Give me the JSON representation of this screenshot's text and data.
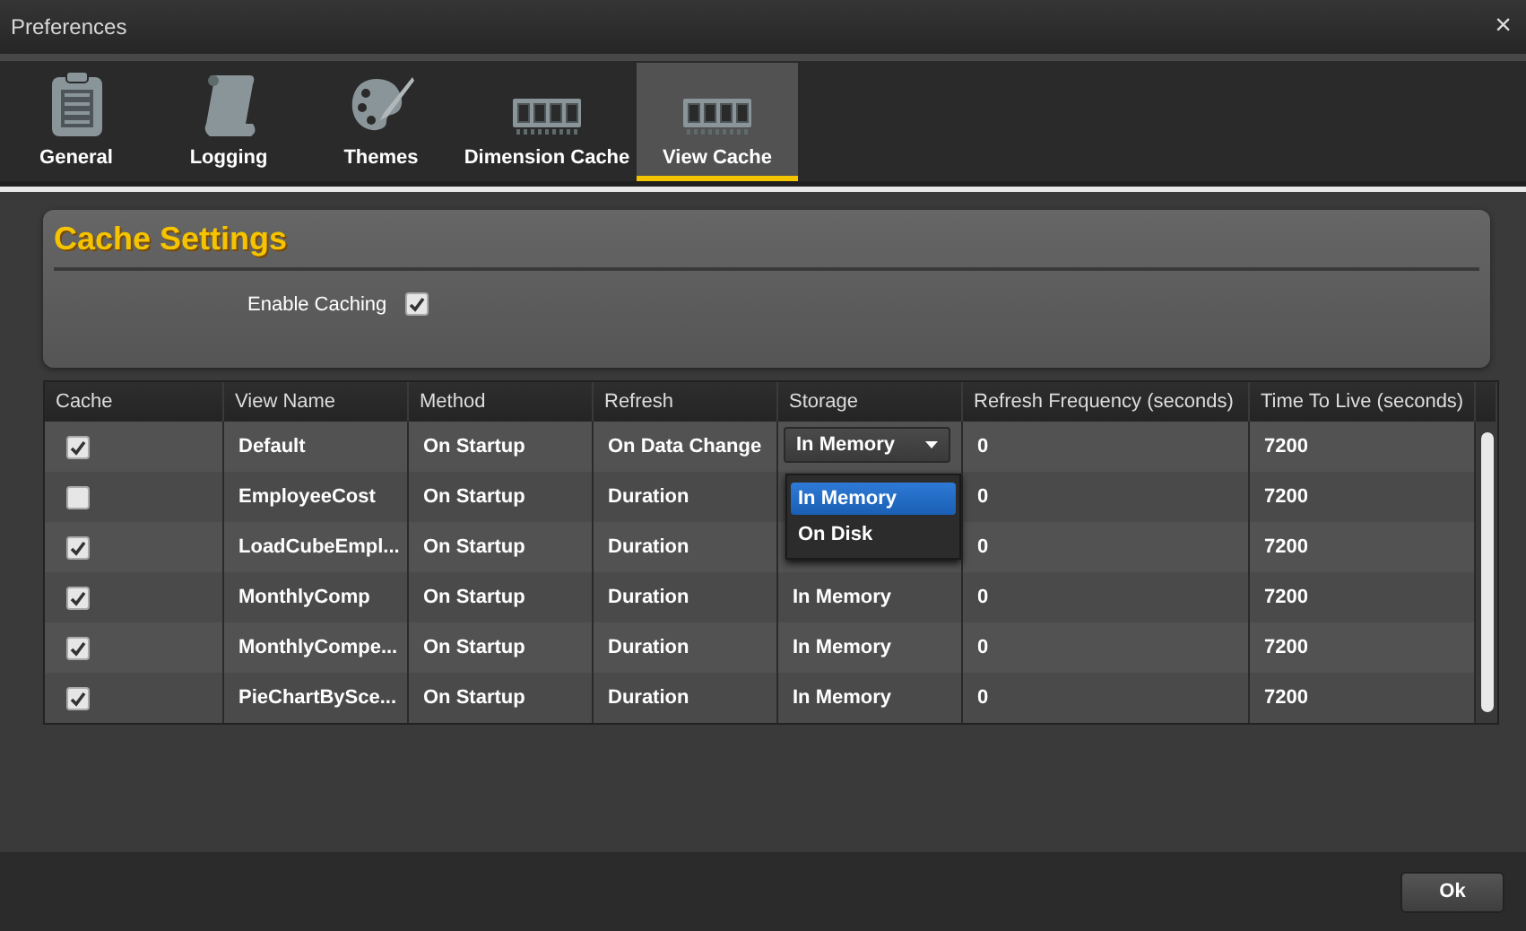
{
  "window": {
    "title": "Preferences",
    "close": "×"
  },
  "tabs": [
    {
      "label": "General",
      "kind": "clipboard",
      "selected": false
    },
    {
      "label": "Logging",
      "kind": "scroll",
      "selected": false
    },
    {
      "label": "Themes",
      "kind": "palette",
      "selected": false
    },
    {
      "label": "Dimension Cache",
      "kind": "memory",
      "selected": false
    },
    {
      "label": "View Cache",
      "kind": "memory",
      "selected": true
    }
  ],
  "settings": {
    "title": "Cache Settings",
    "enable_label": "Enable Caching",
    "enable_checked": true
  },
  "table": {
    "columns": [
      "Cache",
      "View Name",
      "Method",
      "Refresh",
      "Storage",
      "Refresh Frequency (seconds)",
      "Time To Live (seconds)"
    ],
    "rows": [
      {
        "checked": true,
        "name": "Default",
        "method": "On Startup",
        "refresh": "On Data Change",
        "storage": "In Memory",
        "kind": "dropdown",
        "frequency": "0",
        "ttl": "7200"
      },
      {
        "checked": false,
        "name": "EmployeeCost",
        "method": "On Startup",
        "refresh": "Duration",
        "frequency": "0",
        "ttl": "7200"
      },
      {
        "checked": true,
        "name": "LoadCubeEmpl...",
        "method": "On Startup",
        "refresh": "Duration",
        "frequency": "0",
        "ttl": "7200"
      },
      {
        "checked": true,
        "name": "MonthlyComp",
        "method": "On Startup",
        "refresh": "Duration",
        "storage": "In Memory",
        "frequency": "0",
        "ttl": "7200"
      },
      {
        "checked": true,
        "name": "MonthlyCompe...",
        "method": "On Startup",
        "refresh": "Duration",
        "storage": "In Memory",
        "frequency": "0",
        "ttl": "7200"
      },
      {
        "checked": true,
        "name": "PieChartBySce...",
        "method": "On Startup",
        "refresh": "Duration",
        "storage": "In Memory",
        "frequency": "0",
        "ttl": "7200"
      }
    ]
  },
  "dropdown": {
    "options": [
      {
        "label": "In Memory",
        "selected": true
      },
      {
        "label": "On Disk",
        "selected": false
      }
    ]
  },
  "buttons": [
    "Ok"
  ]
}
